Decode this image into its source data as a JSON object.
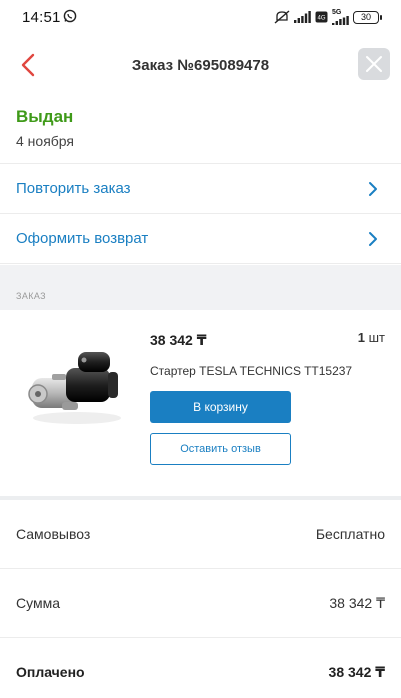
{
  "status_bar": {
    "time": "14:51",
    "battery": "30",
    "network": "5G"
  },
  "header": {
    "title": "Заказ №695089478"
  },
  "order_status": {
    "title": "Выдан",
    "date": "4 ноября",
    "color": "#3f9a19"
  },
  "actions": [
    {
      "label": "Повторить заказ"
    },
    {
      "label": "Оформить возврат"
    }
  ],
  "section_caption": "ЗАКАЗ",
  "product": {
    "price": "38 342 ₸",
    "qty_number": "1",
    "qty_unit": "шт",
    "name": "Стартер TESLA TECHNICS TT15237",
    "cart_button": "В корзину",
    "review_button": "Оставить отзыв"
  },
  "summary": [
    {
      "label": "Самовывоз",
      "value": "Бесплатно"
    },
    {
      "label": "Сумма",
      "value": "38 342 ₸"
    },
    {
      "label": "Оплачено",
      "value": "38 342 ₸"
    }
  ],
  "colors": {
    "accent": "#1a7fc2",
    "back_arrow": "#e0473f"
  }
}
